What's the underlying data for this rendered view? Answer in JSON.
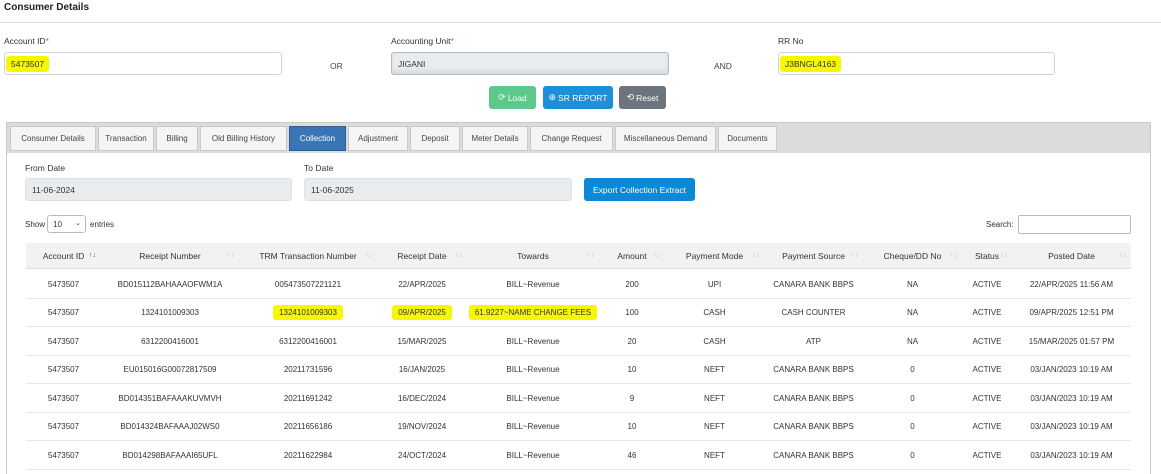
{
  "page_title": "Consumer Details",
  "form": {
    "account_id_label": "Account ID",
    "account_id_value": "5473507",
    "or_label": "OR",
    "accounting_unit_label": "Accounting Unit",
    "accounting_unit_value": "JIGANI",
    "and_label": "AND",
    "rr_no_label": "RR No",
    "rr_no_value": "J3BNGL4163",
    "required_mark": "*"
  },
  "actions": {
    "load_label": "Load",
    "sr_report_label": "SR REPORT",
    "reset_label": "Reset"
  },
  "tabs": [
    "Consumer Details",
    "Transaction",
    "Billing",
    "Old Billing History",
    "Collection",
    "Adjustment",
    "Deposit",
    "Meter Details",
    "Change Request",
    "Miscellaneous Demand",
    "Documents"
  ],
  "active_tab": "Collection",
  "collection": {
    "from_date_label": "From Date",
    "from_date_value": "11-06-2024",
    "to_date_label": "To Date",
    "to_date_value": "11-06-2025",
    "export_label": "Export Collection Extract",
    "show_label": "Show",
    "entries_value": "10",
    "entries_label": "entries",
    "search_label": "Search:"
  },
  "table": {
    "columns": [
      "Account ID",
      "Receipt Number",
      "TRM Transaction Number",
      "Receipt Date",
      "Towards",
      "Amount",
      "Payment Mode",
      "Payment Source",
      "Cheque/DD No",
      "Status",
      "Posted Date"
    ],
    "rows": [
      [
        "5473507",
        "BD015112BAHAAAOFWM1A",
        "005473507221121",
        "22/APR/2025",
        "BILL~Revenue",
        "200",
        "UPI",
        "CANARA BANK BBPS",
        "NA",
        "ACTIVE",
        "22/APR/2025 11:56 AM"
      ],
      [
        "5473507",
        "1324101009303",
        "1324101009303",
        "09/APR/2025",
        "61.9227~NAME CHANGE FEES",
        "100",
        "CASH",
        "CASH COUNTER",
        "NA",
        "ACTIVE",
        "09/APR/2025 12:51 PM"
      ],
      [
        "5473507",
        "6312200416001",
        "6312200416001",
        "15/MAR/2025",
        "BILL~Revenue",
        "20",
        "CASH",
        "ATP",
        "NA",
        "ACTIVE",
        "15/MAR/2025 01:57 PM"
      ],
      [
        "5473507",
        "EU015016G00072817509",
        "20211731596",
        "16/JAN/2025",
        "BILL~Revenue",
        "10",
        "NEFT",
        "CANARA BANK BBPS",
        "0",
        "ACTIVE",
        "03/JAN/2023 10:19 AM"
      ],
      [
        "5473507",
        "BD014351BAFAAAKUVMVH",
        "20211691242",
        "16/DEC/2024",
        "BILL~Revenue",
        "9",
        "NEFT",
        "CANARA BANK BBPS",
        "0",
        "ACTIVE",
        "03/JAN/2023 10:19 AM"
      ],
      [
        "5473507",
        "BD014324BAFAAAJ02WS0",
        "20211656186",
        "19/NOV/2024",
        "BILL~Revenue",
        "10",
        "NEFT",
        "CANARA BANK BBPS",
        "0",
        "ACTIVE",
        "03/JAN/2023 10:19 AM"
      ],
      [
        "5473507",
        "BD014298BAFAAAI65UFL",
        "20211622984",
        "24/OCT/2024",
        "BILL~Revenue",
        "46",
        "NEFT",
        "CANARA BANK BBPS",
        "0",
        "ACTIVE",
        "03/JAN/2023 10:19 AM"
      ]
    ]
  }
}
